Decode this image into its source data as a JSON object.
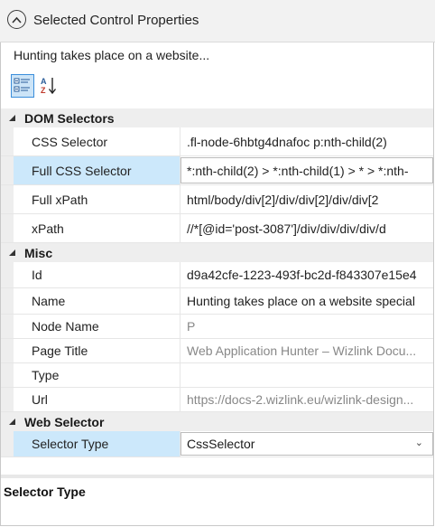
{
  "header": {
    "title": "Selected Control Properties",
    "collapse_icon": "chevron-up-icon"
  },
  "description": "Hunting takes place on a website...",
  "toolbar": {
    "categorized_icon": "categorized-view-icon",
    "alphabetical_icon": "sort-az-icon"
  },
  "categories": [
    {
      "label": "DOM Selectors",
      "rows": [
        {
          "name": "CSS Selector",
          "value": ".fl-node-6hbtg4dnafoc p:nth-child(2)"
        },
        {
          "name": "Full CSS Selector",
          "value": "*:nth-child(2) > *:nth-child(1) > * > *:nth-"
        },
        {
          "name": "Full xPath",
          "value": "html/body/div[2]/div/div[2]/div/div[2"
        },
        {
          "name": "xPath",
          "value": "//*[@id='post-3087']/div/div/div/div/d"
        }
      ]
    },
    {
      "label": "Misc",
      "rows": [
        {
          "name": "Id",
          "value": "d9a42cfe-1223-493f-bc2d-f843307e15e4"
        },
        {
          "name": "Name",
          "value": "Hunting takes place on a website special"
        },
        {
          "name": "Node Name",
          "value": "P"
        },
        {
          "name": "Page Title",
          "value": "Web Application Hunter – Wizlink Docu..."
        },
        {
          "name": "Type",
          "value": ""
        },
        {
          "name": "Url",
          "value": "https://docs-2.wizlink.eu/wizlink-design..."
        }
      ]
    },
    {
      "label": "Web Selector",
      "rows": [
        {
          "name": "Selector Type",
          "value": "CssSelector"
        }
      ]
    }
  ],
  "help": {
    "title": "Selector Type"
  }
}
